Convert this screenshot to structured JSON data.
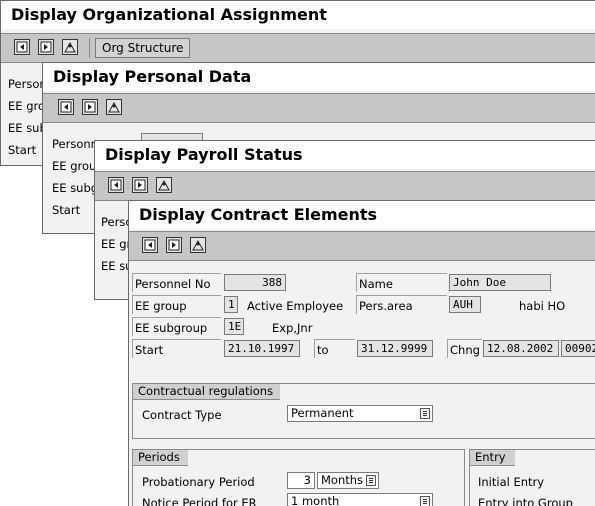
{
  "org": {
    "title": "Display Organizational Assignment",
    "org_structure_button": "Org Structure",
    "labels": [
      "Person",
      "EE grou",
      "EE subg",
      "Start"
    ]
  },
  "personal": {
    "title": "Display Personal Data",
    "labels": [
      "Personn",
      "EE grou",
      "EE subg",
      "Start"
    ]
  },
  "payroll": {
    "title": "Display Payroll Status",
    "labels": [
      "Perso",
      "EE gr",
      "EE su"
    ]
  },
  "contract": {
    "title": "Display Contract Elements",
    "header": {
      "personnel_no_label": "Personnel No",
      "personnel_no": "388",
      "name_label": "Name",
      "name": "John Doe",
      "ee_group_label": "EE group",
      "ee_group_code": "1",
      "ee_group_text": "Active Employee",
      "pers_area_label": "Pers.area",
      "pers_area_code": "AUH",
      "pers_area_text": "habi HO",
      "ee_subgroup_label": "EE subgroup",
      "ee_subgroup_code": "1E",
      "ee_subgroup_text": "Exp,Jnr",
      "start_label": "Start",
      "start": "21.10.1997",
      "to_label": "to",
      "end": "31.12.9999",
      "chng_label": "Chng",
      "chng_date": "12.08.2002",
      "chng_user": "00902"
    },
    "contractual": {
      "title": "Contractual regulations",
      "contract_type_label": "Contract Type",
      "contract_type": "Permanent"
    },
    "periods": {
      "title": "Periods",
      "probationary_label": "Probationary Period",
      "probationary_value": "3",
      "probationary_unit": "Months",
      "notice_label": "Notice Period for ER",
      "notice_value": "1 month"
    },
    "entry": {
      "title": "Entry",
      "initial_entry_label": "Initial Entry",
      "entry_group_label": "Entry into Group"
    }
  }
}
